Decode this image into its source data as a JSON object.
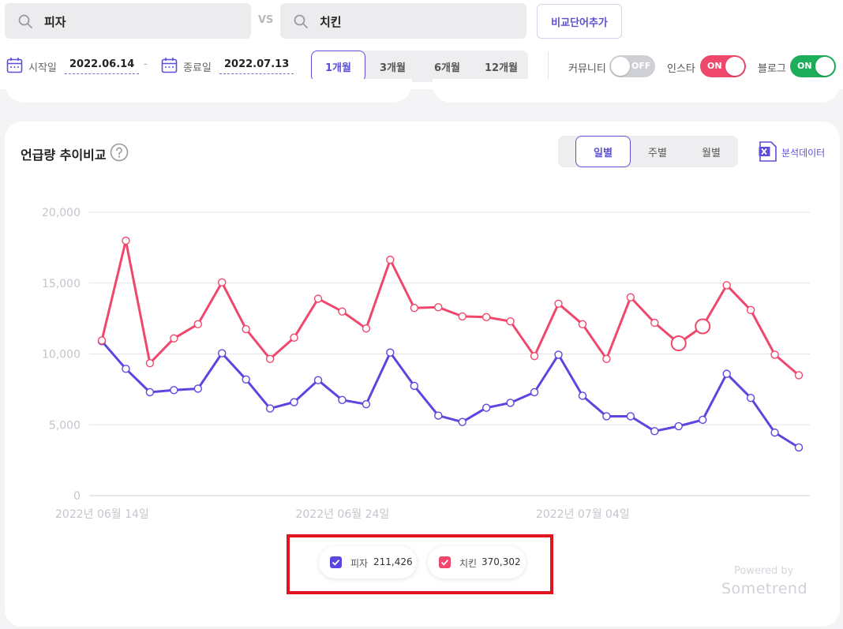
{
  "search": {
    "term1": "피자",
    "vs": "VS",
    "term2": "치킨",
    "add_button": "비교단어추가"
  },
  "dates": {
    "start_label": "시작일",
    "start_value": "2022.06.14",
    "separator": "-",
    "end_label": "종료일",
    "end_value": "2022.07.13"
  },
  "period": {
    "options": [
      "1개월",
      "3개월",
      "6개월",
      "12개월"
    ],
    "selected": "1개월"
  },
  "sources": [
    {
      "label": "커뮤니티",
      "state": "OFF",
      "on": false,
      "color": "#cfcfd6"
    },
    {
      "label": "인스타",
      "state": "ON",
      "on": true,
      "color": "#f0486c"
    },
    {
      "label": "블로그",
      "state": "ON",
      "on": true,
      "color": "#1dae5a"
    }
  ],
  "panel": {
    "title": "언급량 추이비교",
    "help_icon": "question-circle-icon",
    "unit_options": [
      "일별",
      "주별",
      "월별"
    ],
    "unit_selected": "일별",
    "export_icon": "excel-icon",
    "export_label": "분석데이터"
  },
  "legend": [
    {
      "name": "피자",
      "value": "211,426",
      "color": "#5b47e0"
    },
    {
      "name": "치킨",
      "value": "370,302",
      "color": "#f0486c"
    }
  ],
  "branding": {
    "powered": "Powered by",
    "name": "Sometrend"
  },
  "chart_data": {
    "type": "line",
    "x": [
      "2022-06-14",
      "2022-06-15",
      "2022-06-16",
      "2022-06-17",
      "2022-06-18",
      "2022-06-19",
      "2022-06-20",
      "2022-06-21",
      "2022-06-22",
      "2022-06-23",
      "2022-06-24",
      "2022-06-25",
      "2022-06-26",
      "2022-06-27",
      "2022-06-28",
      "2022-06-29",
      "2022-06-30",
      "2022-07-01",
      "2022-07-02",
      "2022-07-03",
      "2022-07-04",
      "2022-07-05",
      "2022-07-06",
      "2022-07-07",
      "2022-07-08",
      "2022-07-09",
      "2022-07-10",
      "2022-07-11",
      "2022-07-12",
      "2022-07-13"
    ],
    "x_tick_labels": [
      "2022년 06월 14일",
      "2022년 06월 24일",
      "2022년 07월 04일"
    ],
    "x_tick_index": [
      0,
      10,
      20
    ],
    "y_ticks": [
      0,
      5000,
      10000,
      15000,
      20000
    ],
    "y_tick_labels": [
      "0",
      "5,000",
      "10,000",
      "15,000",
      "20,000"
    ],
    "ylim": [
      0,
      20000
    ],
    "grid": true,
    "series": [
      {
        "name": "피자",
        "color": "#5b47e0",
        "values": [
          10900,
          8950,
          7300,
          7450,
          7550,
          10050,
          8200,
          6150,
          6600,
          8150,
          6750,
          6450,
          10100,
          7750,
          5650,
          5200,
          6200,
          6550,
          7300,
          9950,
          7050,
          5600,
          5600,
          4550,
          4900,
          5350,
          8600,
          6900,
          4450,
          3400
        ]
      },
      {
        "name": "치킨",
        "color": "#f0486c",
        "values": [
          10950,
          18000,
          9350,
          11100,
          12100,
          15050,
          11750,
          9650,
          11150,
          13900,
          13000,
          11800,
          16650,
          13250,
          13300,
          12650,
          12600,
          12300,
          9850,
          13550,
          12100,
          9650,
          14000,
          12200,
          10750,
          11950,
          14850,
          13100,
          9950,
          8500
        ]
      }
    ]
  }
}
